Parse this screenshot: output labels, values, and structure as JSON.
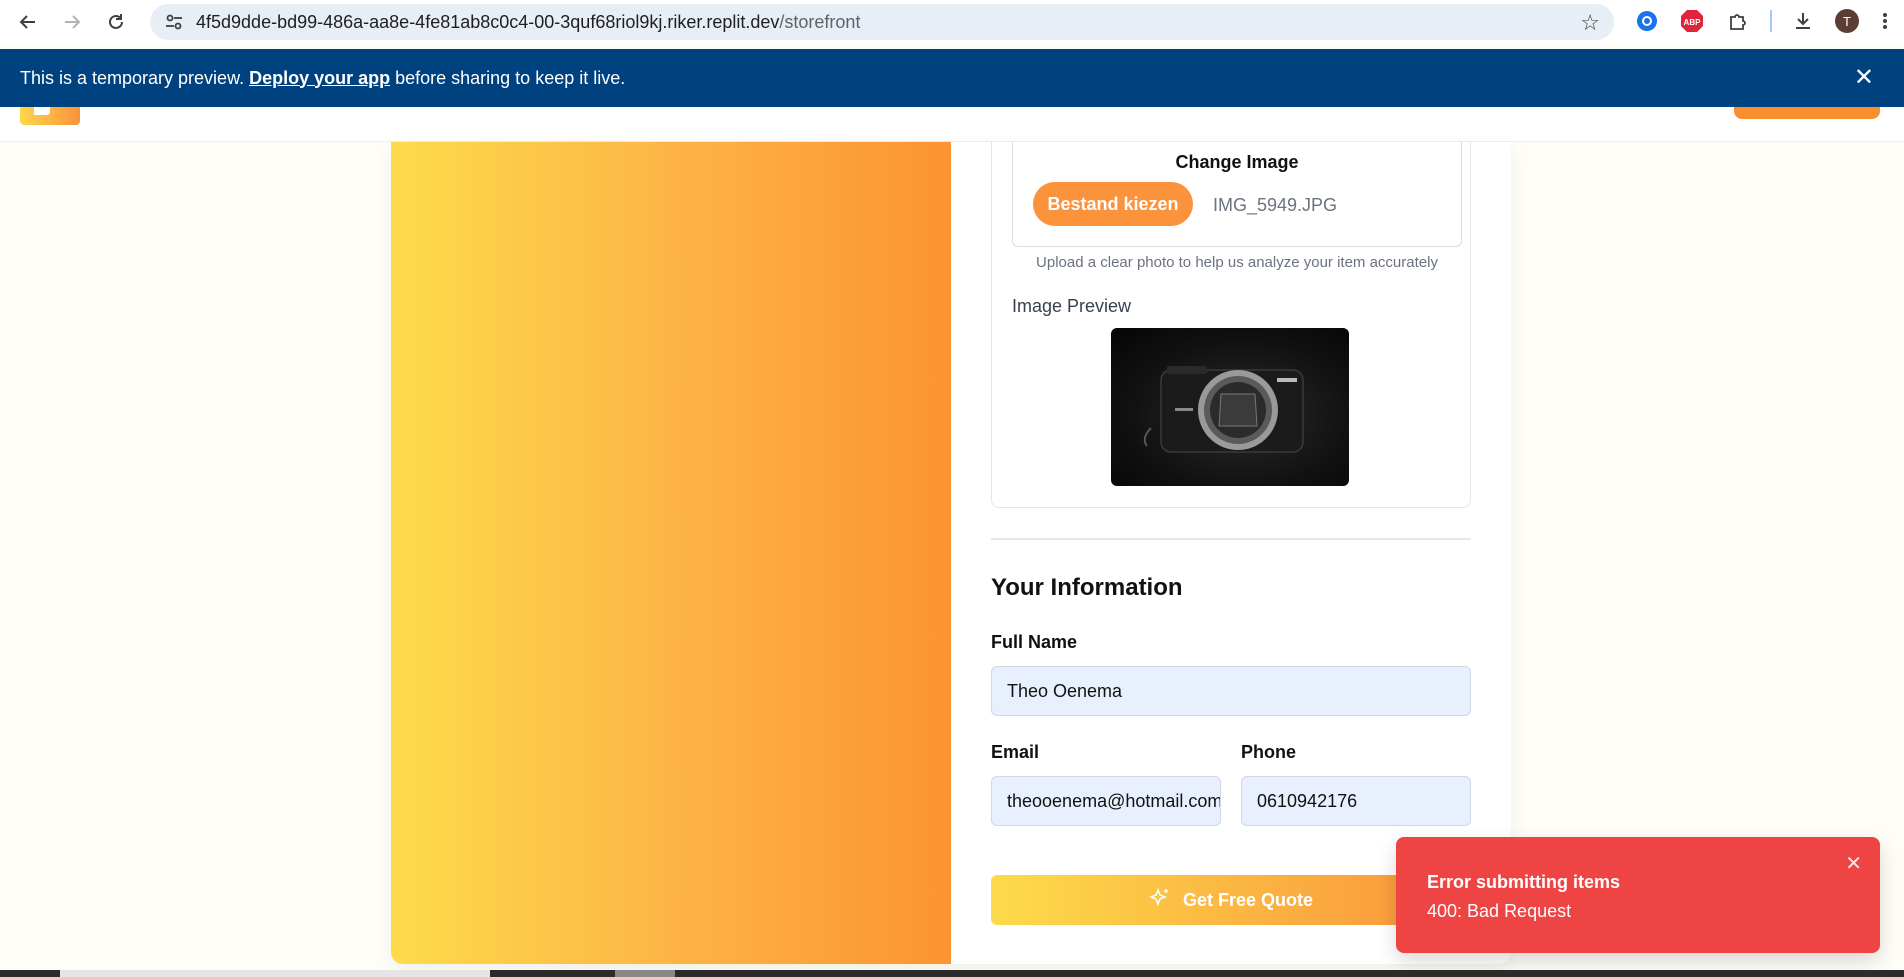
{
  "browser": {
    "url_host": "4f5d9dde-bd99-486a-aa8e-4fe81ab8c0c4-00-3quf68riol9kj.riker.replit.dev",
    "url_path": "/storefront",
    "profile_initial": "T",
    "extensions": [
      "chrome-extension-icon",
      "adblock-plus-icon",
      "puzzle-icon"
    ]
  },
  "banner": {
    "text_before": "This is a temporary preview.",
    "link": "Deploy your app",
    "text_after": "before sharing to keep it live."
  },
  "upload": {
    "change_label": "Change Image",
    "button_label": "Bestand kiezen",
    "file_name": "IMG_5949.JPG",
    "help_text": "Upload a clear photo to help us analyze your item accurately",
    "preview_label": "Image Preview"
  },
  "info": {
    "title": "Your Information",
    "name_label": "Full Name",
    "name_value": "Theo Oenema",
    "email_label": "Email",
    "email_value": "theooenema@hotmail.com",
    "phone_label": "Phone",
    "phone_value": "0610942176"
  },
  "submit": {
    "label": "Get Free Quote"
  },
  "toast": {
    "title": "Error submitting items",
    "message": "400: Bad Request"
  },
  "colors": {
    "accent": "#fb923c",
    "banner": "#00417f",
    "error": "#ef4444"
  }
}
